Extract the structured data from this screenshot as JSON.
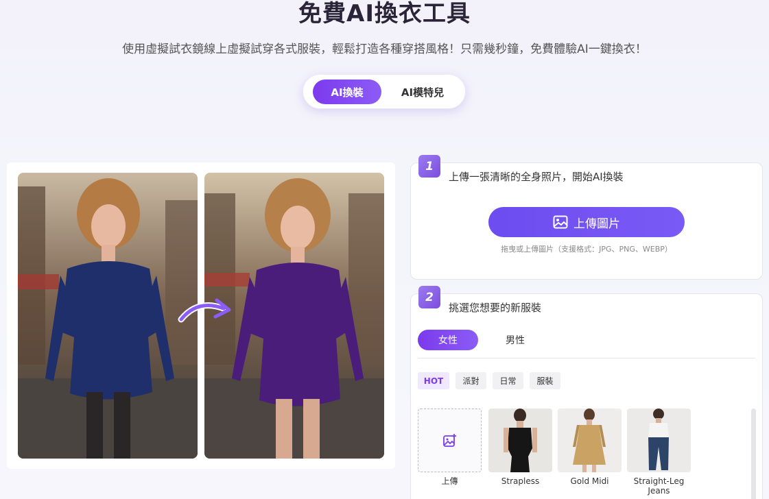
{
  "header": {
    "title": "免費AI換衣工具",
    "subtitle": "使用虛擬試衣鏡線上虛擬試穿各式服裝，輕鬆打造各種穿搭風格！只需幾秒鐘，免費體驗AI一鍵換衣！"
  },
  "mode_tabs": [
    {
      "label": "AI換裝",
      "active": true
    },
    {
      "label": "AI模特兒",
      "active": false
    }
  ],
  "preview": {
    "before_icon": "woman-navy-dress-photo",
    "after_icon": "woman-purple-dress-photo",
    "arrow_icon": "curved-arrow-icon"
  },
  "step1": {
    "badge": "1",
    "label": "上傳一張清晰的全身照片，開始AI換裝",
    "upload_button": "上傳圖片",
    "hint": "拖曳或上傳圖片（支援格式：JPG、PNG、WEBP）"
  },
  "step2": {
    "badge": "2",
    "label": "挑選您想要的新服裝",
    "gender_tabs": [
      {
        "label": "女性",
        "active": true
      },
      {
        "label": "男性",
        "active": false
      }
    ],
    "categories": [
      {
        "label": "HOT",
        "active": true
      },
      {
        "label": "派對",
        "active": false
      },
      {
        "label": "日常",
        "active": false
      },
      {
        "label": "服裝",
        "active": false
      }
    ],
    "outfits": [
      {
        "label": "上傳"
      },
      {
        "label": "Strapless"
      },
      {
        "label": "Gold Midi"
      },
      {
        "label": "Straight-Leg Jeans"
      }
    ]
  },
  "colors": {
    "accent": "#7c3aed",
    "button": "#6d4cf0",
    "navy_dress": "#1f2f6b",
    "purple_dress": "#4a1d7a"
  }
}
